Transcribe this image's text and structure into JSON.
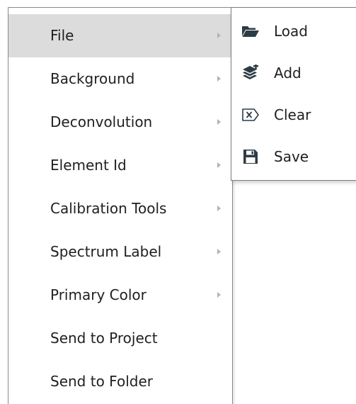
{
  "main_menu": {
    "items": [
      {
        "label": "File",
        "has_submenu": true,
        "highlighted": true
      },
      {
        "label": "Background",
        "has_submenu": true
      },
      {
        "label": "Deconvolution",
        "has_submenu": true
      },
      {
        "label": "Element Id",
        "has_submenu": true
      },
      {
        "label": "Calibration Tools",
        "has_submenu": true
      },
      {
        "label": "Spectrum Label",
        "has_submenu": true
      },
      {
        "label": "Primary Color",
        "has_submenu": true
      },
      {
        "label": "Send to Project",
        "has_submenu": false
      },
      {
        "label": "Send to Folder",
        "has_submenu": false
      }
    ]
  },
  "file_submenu": {
    "items": [
      {
        "label": "Load",
        "icon": "folder-open-icon"
      },
      {
        "label": "Add",
        "icon": "layers-add-icon"
      },
      {
        "label": "Clear",
        "icon": "clear-x-icon"
      },
      {
        "label": "Save",
        "icon": "floppy-disk-icon"
      }
    ]
  },
  "colors": {
    "highlight": "#dcdcdc",
    "border": "#8a8a8a",
    "text": "#1f1f1f",
    "arrow": "#b4b4b4",
    "icon": "#2d3b45"
  }
}
